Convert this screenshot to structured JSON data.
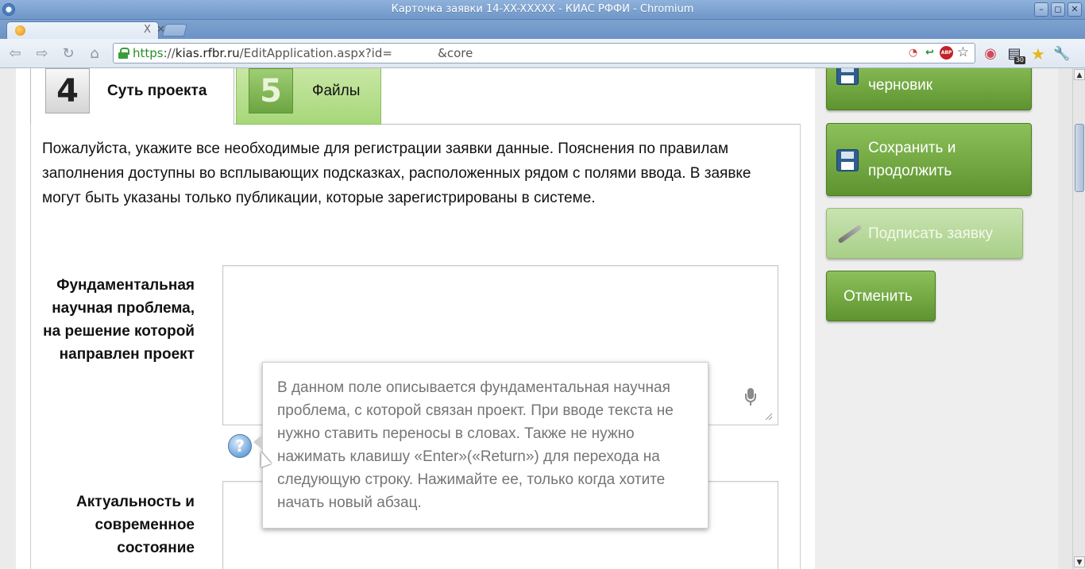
{
  "window": {
    "title": "Карточка заявки 14-XX-XXXXX - КИАС РФФИ - Chromium",
    "buttons": [
      "–",
      "◻",
      "✕"
    ]
  },
  "tabs": {
    "active_title": "",
    "close_glyph": "X",
    "extra_glyph": "✕"
  },
  "toolbar": {
    "back_glyph": "⇦",
    "forward_glyph": "⇨",
    "reload_glyph": "↻",
    "home_glyph": "⌂",
    "url_scheme": "https",
    "url_sep": "://",
    "url_host": "kias.rfbr.ru",
    "url_path": "/EditApplication.aspx?id=            &core",
    "omni_icons": [
      "◔",
      "↩",
      "ABP",
      "☆"
    ],
    "extensions": [
      "◉",
      "▤",
      "★",
      "🔧"
    ],
    "extension_badge": "30"
  },
  "steps": {
    "current": {
      "number": "4",
      "label": "Суть проекта"
    },
    "next": {
      "number": "5",
      "label": "Файлы"
    }
  },
  "intro_text": "Пожалуйста, укажите все необходимые для регистрации заявки данные. Пояснения по правилам заполнения доступны во всплывающих подсказках, расположенных рядом с полями ввода. В заявке могут быть указаны только публикации, которые зарегистрированы в системе.",
  "fields": {
    "problem": {
      "label": "Фундаментальная научная проблема, на решение которой направлен проект",
      "value": ""
    },
    "relevance": {
      "label": "Актуальность и современное состояние",
      "value": ""
    }
  },
  "help": {
    "glyph": "?",
    "tooltip": "В данном поле описывается фундаментальная научная проблема, с которой связан проект. При вводе текста не нужно ставить переносы в словах. Также не нужно нажимать клавишу «Enter»(«Return») для перехода на следующую строку. Нажимайте ее, только когда хотите начать новый абзац."
  },
  "sidebar": {
    "save_draft_label": "черновик",
    "save_continue_label": "Сохранить и продолжить",
    "sign_label": "Подписать заявку",
    "cancel_label": "Отменить"
  },
  "scrollbar": {
    "up": "▲",
    "down": "▼"
  },
  "colors": {
    "button_green": "#6fa640",
    "button_green_disabled": "#b6d99a",
    "tab_green": "#a7d77a",
    "title_bar": "#7ea2cf"
  }
}
